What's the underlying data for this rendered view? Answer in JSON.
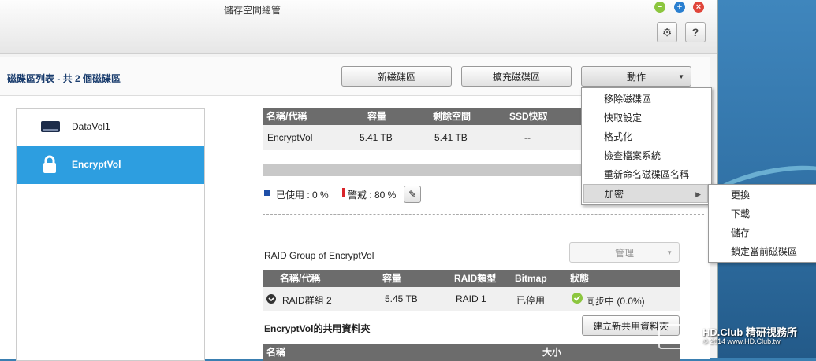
{
  "window": {
    "title": "儲存空間總管"
  },
  "header": {
    "volume_count": "磁碟區列表 - 共 2 個磁碟區",
    "new_volume": "新磁碟區",
    "expand_volume": "擴充磁碟區",
    "action": "動作"
  },
  "sidebar": {
    "items": [
      {
        "label": "DataVol1",
        "icon": "drive-icon"
      },
      {
        "label": "EncryptVol",
        "icon": "lock-icon"
      }
    ]
  },
  "volume_table": {
    "headers": [
      "名稱/代稱",
      "容量",
      "剩餘空間",
      "SSD快取"
    ],
    "row": {
      "name": "EncryptVol",
      "capacity": "5.41 TB",
      "free": "5.41 TB",
      "ssd": "--"
    }
  },
  "usage": {
    "used": "已使用 : 0 %",
    "warning": "警戒 : 80 %",
    "used_color": "#1f4fa8",
    "warning_color": "#d9242b"
  },
  "raid": {
    "title": "RAID Group of EncryptVol",
    "manage": "管理",
    "headers": [
      "名稱/代稱",
      "容量",
      "RAID類型",
      "Bitmap",
      "狀態"
    ],
    "row": {
      "name": "RAID群組 2",
      "capacity": "5.45 TB",
      "type": "RAID 1",
      "bitmap": "已停用",
      "status": "同步中 (0.0%)"
    }
  },
  "shared": {
    "title": "EncryptVol的共用資料夾",
    "create": "建立新共用資料夾",
    "headers": [
      "名稱",
      "大小"
    ]
  },
  "action_menu": {
    "items": [
      "移除磁碟區",
      "快取設定",
      "格式化",
      "檢查檔案系統",
      "重新命名磁碟區名稱",
      "加密"
    ]
  },
  "encrypt_menu": {
    "items": [
      "更換",
      "下載",
      "儲存",
      "鎖定當前磁碟區"
    ]
  },
  "watermark": {
    "name": "HD.Club 精研視務所",
    "copy": "© 2014  www.HD.Club.tw"
  }
}
